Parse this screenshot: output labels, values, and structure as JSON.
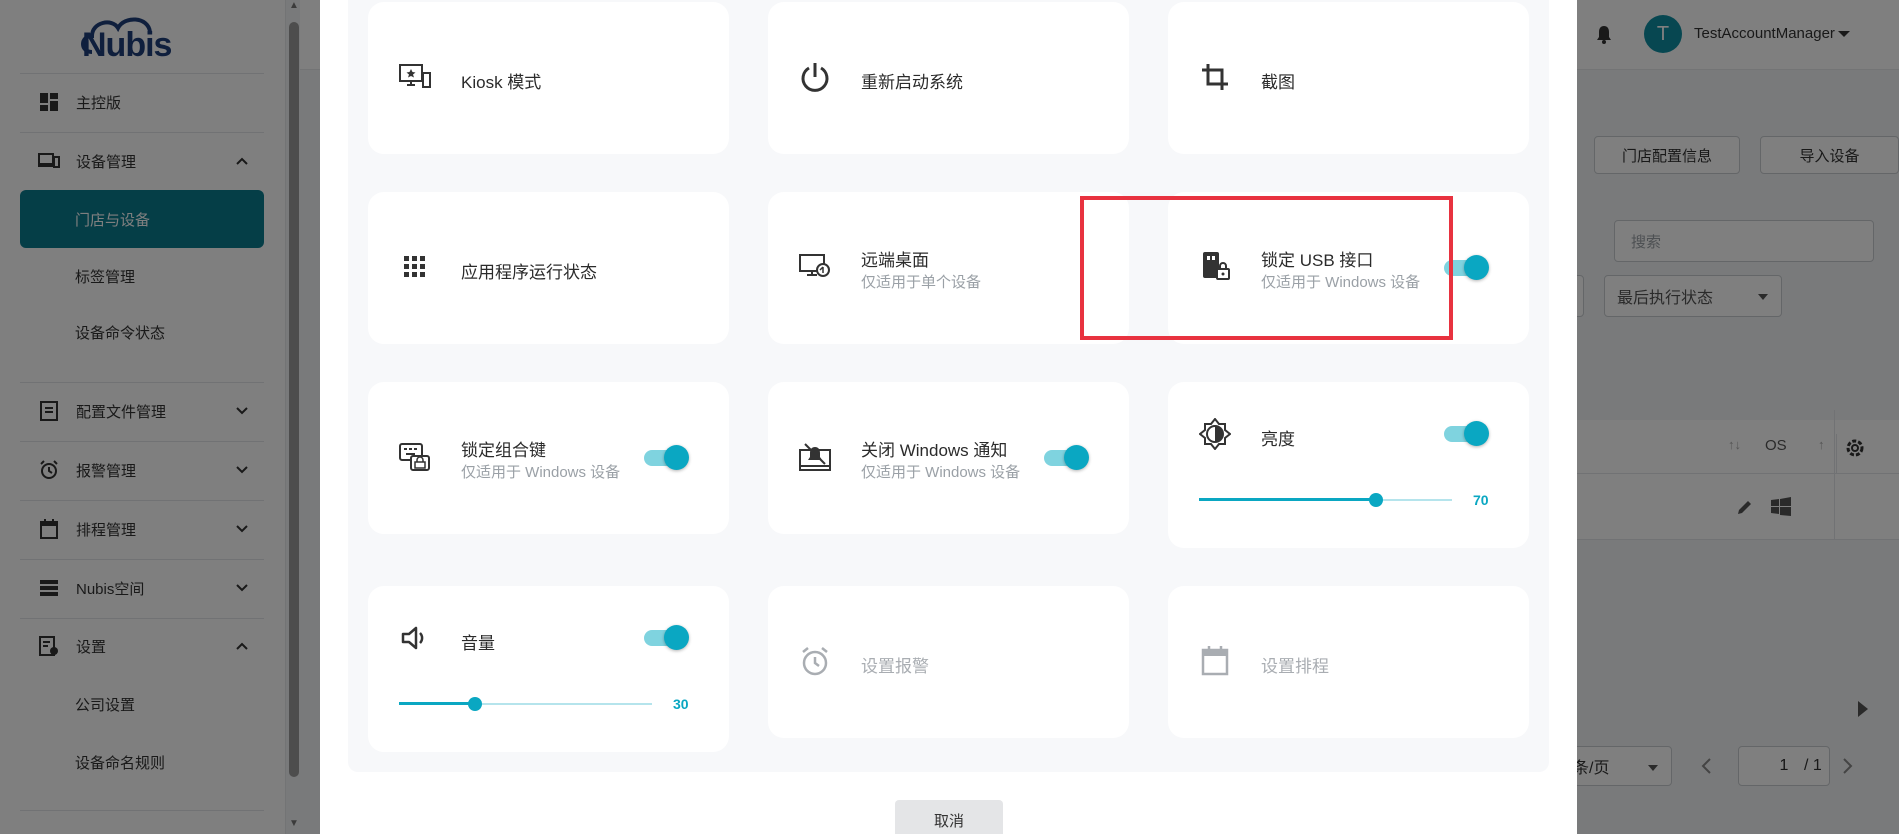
{
  "sidebar": {
    "logo_text": "Nubis",
    "items": [
      {
        "label": "主控版",
        "icon": "dashboard-icon"
      },
      {
        "label": "设备管理",
        "icon": "devices-icon"
      },
      {
        "label": "配置文件管理",
        "icon": "profile-icon"
      },
      {
        "label": "报警管理",
        "icon": "alarm-icon"
      },
      {
        "label": "排程管理",
        "icon": "calendar-icon"
      },
      {
        "label": "Nubis空间",
        "icon": "storage-icon"
      },
      {
        "label": "设置",
        "icon": "settings-doc-icon"
      }
    ],
    "device_sub": [
      "门店与设备",
      "标签管理",
      "设备命令状态"
    ],
    "settings_sub": [
      "公司设置",
      "设备命名规则"
    ]
  },
  "header": {
    "avatar_letter": "T",
    "username": "TestAccountManager"
  },
  "background": {
    "store_config_button": "门店配置信息",
    "import_button": "导入设备",
    "search_placeholder": "搜索",
    "last_status_select": "最后执行状态",
    "os_column": "OS",
    "per_page": "条/页",
    "page_current": "1",
    "page_total": "/ 1"
  },
  "modal": {
    "cards": {
      "kiosk": {
        "title": "Kiosk 模式"
      },
      "restart": {
        "title": "重新启动系统"
      },
      "screenshot": {
        "title": "截图"
      },
      "app_status": {
        "title": "应用程序运行状态"
      },
      "remote_desktop": {
        "title": "远端桌面",
        "subtitle": "仅适用于单个设备"
      },
      "lock_usb": {
        "title": "锁定 USB 接口",
        "subtitle": "仅适用于 Windows 设备",
        "enabled": true
      },
      "lock_keys": {
        "title": "锁定组合键",
        "subtitle": "仅适用于 Windows 设备",
        "enabled": true
      },
      "disable_notif": {
        "title": "关闭 Windows 通知",
        "subtitle": "仅适用于 Windows 设备",
        "enabled": true
      },
      "brightness": {
        "title": "亮度",
        "enabled": true,
        "value": 70,
        "value_label": "70"
      },
      "volume": {
        "title": "音量",
        "enabled": true,
        "value": 30,
        "value_label": "30"
      },
      "set_alarm": {
        "title": "设置报警",
        "disabled": true
      },
      "set_schedule": {
        "title": "设置排程",
        "disabled": true
      }
    },
    "cancel_label": "取消"
  },
  "colors": {
    "accent": "#0aa7c2",
    "active_nav": "#0b7c8f",
    "highlight": "#e8323f"
  }
}
